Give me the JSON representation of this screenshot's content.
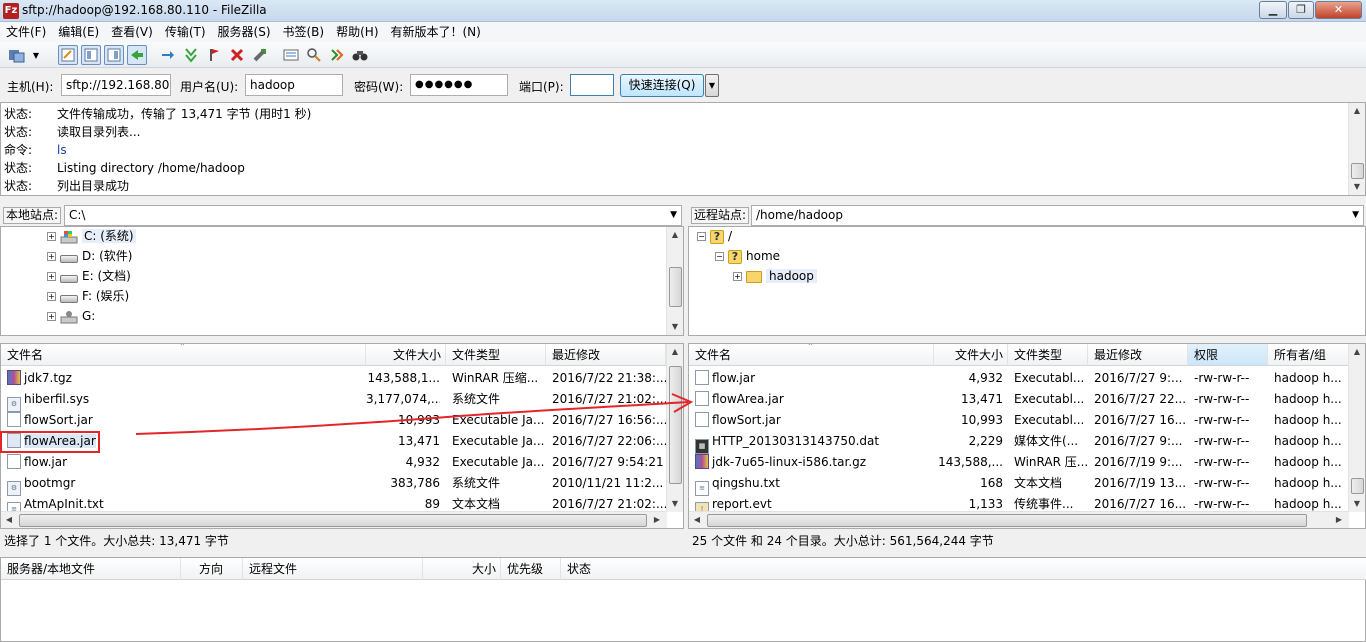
{
  "window": {
    "title": "sftp://hadoop@192.168.80.110 - FileZilla",
    "app_icon": "Fz",
    "controls": [
      "minimize",
      "maximize",
      "close"
    ],
    "control_glyphs": [
      "▁",
      "❐",
      "✕"
    ]
  },
  "menu": [
    "文件(F)",
    "编辑(E)",
    "查看(V)",
    "传输(T)",
    "服务器(S)",
    "书签(B)",
    "帮助(H)",
    "有新版本了！(N)"
  ],
  "toolbar": {
    "icons": [
      "site-manager-icon",
      "dropdown-icon",
      "toggle-log-icon",
      "toggle-local-tree-icon",
      "toggle-remote-tree-icon",
      "toggle-queue-icon",
      "refresh-icon",
      "process-queue-icon",
      "cancel-icon",
      "disconnect-icon",
      "reconnect-icon",
      "directory-compare-icon",
      "filter-icon",
      "sync-browse-icon",
      "search-icon"
    ]
  },
  "connect": {
    "host_label": "主机(H):",
    "host_value": "sftp://192.168.80.",
    "user_label": "用户名(U):",
    "user_value": "hadoop",
    "pass_label": "密码(W):",
    "pass_value": "●●●●●●",
    "port_label": "端口(P):",
    "port_value": "",
    "quick_connect": "快速连接(Q)"
  },
  "log": [
    {
      "k": "状态:",
      "v": "文件传输成功，传输了 13,471 字节 (用时1 秒)"
    },
    {
      "k": "状态:",
      "v": "读取目录列表..."
    },
    {
      "k": "命令:",
      "v": "ls"
    },
    {
      "k": "状态:",
      "v": "Listing directory /home/hadoop"
    },
    {
      "k": "状态:",
      "v": "列出目录成功"
    }
  ],
  "local": {
    "site_label": "本地站点:",
    "path": "C:\\",
    "tree": [
      {
        "label": "C: (系统)",
        "icon": "system-drive-icon"
      },
      {
        "label": "D: (软件)",
        "icon": "drive-icon"
      },
      {
        "label": "E: (文档)",
        "icon": "drive-icon"
      },
      {
        "label": "F: (娱乐)",
        "icon": "drive-icon"
      },
      {
        "label": "G:",
        "icon": "network-drive-icon"
      }
    ],
    "columns": [
      "文件名",
      "文件大小",
      "文件类型",
      "最近修改"
    ],
    "files": [
      {
        "name": "jdk7.tgz",
        "size": "143,588,1...",
        "type": "WinRAR 压缩...",
        "modified": "2016/7/22 21:38:...",
        "icon": "rar"
      },
      {
        "name": "hiberfil.sys",
        "size": "3,177,074,...",
        "type": "系统文件",
        "modified": "2016/7/27 21:02:...",
        "icon": "sys"
      },
      {
        "name": "flowSort.jar",
        "size": "10,993",
        "type": "Executable Ja...",
        "modified": "2016/7/27 16:56:...",
        "icon": "jar"
      },
      {
        "name": "flowArea.jar",
        "size": "13,471",
        "type": "Executable Ja...",
        "modified": "2016/7/27 22:06:...",
        "icon": "jar"
      },
      {
        "name": "flow.jar",
        "size": "4,932",
        "type": "Executable Ja...",
        "modified": "2016/7/27 9:54:21",
        "icon": "jar"
      },
      {
        "name": "bootmgr",
        "size": "383,786",
        "type": "系统文件",
        "modified": "2010/11/21 11:2...",
        "icon": "sys"
      },
      {
        "name": "AtmApInit.txt",
        "size": "89",
        "type": "文本文档",
        "modified": "2016/7/27 21:02:...",
        "icon": "txt"
      }
    ],
    "status": "选择了 1 个文件。大小总共: 13,471 字节"
  },
  "remote": {
    "site_label": "远程站点:",
    "path": "/home/hadoop",
    "tree": [
      {
        "label": "/",
        "icon": "unknown-folder-icon"
      },
      {
        "label": "home",
        "icon": "unknown-folder-icon"
      },
      {
        "label": "hadoop",
        "icon": "folder-icon"
      }
    ],
    "columns": [
      "文件名",
      "文件大小",
      "文件类型",
      "最近修改",
      "权限",
      "所有者/组"
    ],
    "files": [
      {
        "name": "flow.jar",
        "size": "4,932",
        "type": "Executabl...",
        "modified": "2016/7/27 9:...",
        "perm": "-rw-rw-r--",
        "owner": "hadoop h...",
        "icon": "jar"
      },
      {
        "name": "flowArea.jar",
        "size": "13,471",
        "type": "Executabl...",
        "modified": "2016/7/27 22...",
        "perm": "-rw-rw-r--",
        "owner": "hadoop h...",
        "icon": "jar"
      },
      {
        "name": "flowSort.jar",
        "size": "10,993",
        "type": "Executabl...",
        "modified": "2016/7/27 16...",
        "perm": "-rw-rw-r--",
        "owner": "hadoop h...",
        "icon": "jar"
      },
      {
        "name": "HTTP_20130313143750.dat",
        "size": "2,229",
        "type": "媒体文件(...",
        "modified": "2016/7/27 9:...",
        "perm": "-rw-rw-r--",
        "owner": "hadoop h...",
        "icon": "dat"
      },
      {
        "name": "jdk-7u65-linux-i586.tar.gz",
        "size": "143,588,...",
        "type": "WinRAR 压...",
        "modified": "2016/7/19 9:...",
        "perm": "-rw-rw-r--",
        "owner": "hadoop h...",
        "icon": "rar"
      },
      {
        "name": "qingshu.txt",
        "size": "168",
        "type": "文本文档",
        "modified": "2016/7/19 13...",
        "perm": "-rw-rw-r--",
        "owner": "hadoop h...",
        "icon": "txt"
      },
      {
        "name": "report.evt",
        "size": "1,133",
        "type": "传统事件...",
        "modified": "2016/7/27 16...",
        "perm": "-rw-rw-r--",
        "owner": "hadoop h...",
        "icon": "evt"
      }
    ],
    "status": "25 个文件 和 24 个目录。大小总计: 561,564,244 字节"
  },
  "queue": {
    "columns": [
      "服务器/本地文件",
      "方向",
      "远程文件",
      "大小",
      "优先级",
      "状态"
    ]
  },
  "annotation": {
    "color": "#e3262a"
  }
}
